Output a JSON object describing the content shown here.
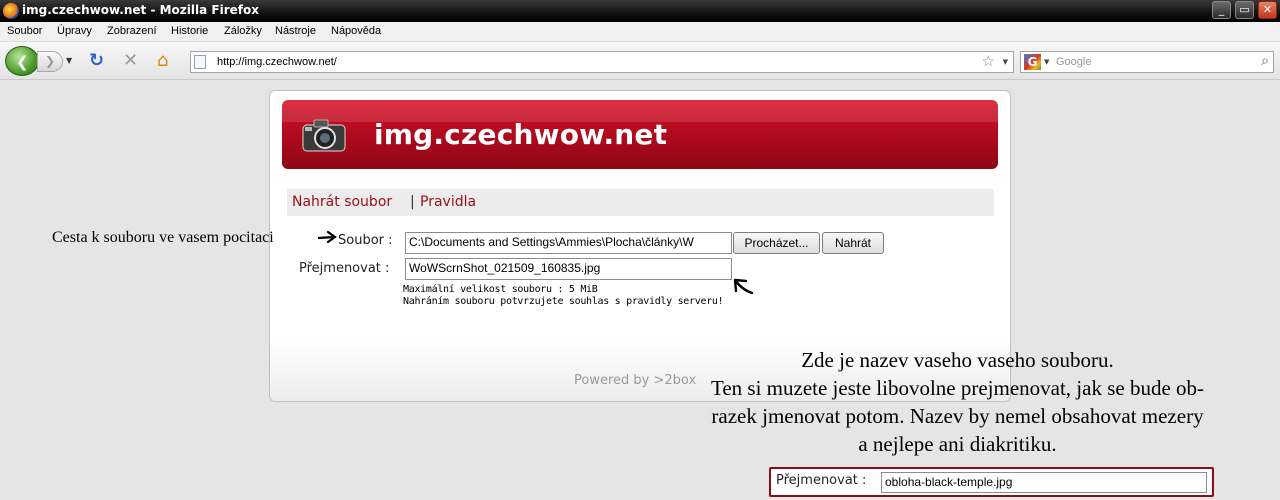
{
  "window": {
    "title": "img.czechwow.net - Mozilla Firefox"
  },
  "menu": [
    "Soubor",
    "Úpravy",
    "Zobrazení",
    "Historie",
    "Záložky",
    "Nástroje",
    "Nápověda"
  ],
  "urlbar": {
    "url": "http://img.czechwow.net/"
  },
  "searchbar": {
    "placeholder": "Google"
  },
  "page": {
    "site_title": "img.czechwow.net",
    "tabs": {
      "upload": "Nahrát soubor",
      "separator": "|",
      "rules": "Pravidla"
    },
    "form": {
      "file_label": "Soubor :",
      "file_value": "C:\\Documents and Settings\\Ammies\\Plocha\\články\\W",
      "browse_button": "Procházet...",
      "upload_button": "Nahrát",
      "rename_label": "Přejmenovat :",
      "rename_value": "WoWScrnShot_021509_160835.jpg",
      "max_size": "Maximální velikost souboru : 5 MiB",
      "agreement": "Nahráním souboru potvrzujete souhlas s pravidly serveru!"
    },
    "powered": "Powered by >2box"
  },
  "annotations": {
    "left": "Cesta k souboru ve vasem pocitaci",
    "right": [
      "Zde je nazev vaseho vaseho souboru.",
      "Ten si muzete jeste libovolne prejmenovat, jak se bude ob-",
      "razek jmenovat potom. Nazev by nemel obsahovat mezery",
      "a nejlepe ani diakritiku."
    ],
    "zoom_label": "Přejmenovat :",
    "zoom_value": "obloha-black-temple.jpg"
  },
  "colors": {
    "accent": "#b30b1e",
    "link": "#9b0d1c"
  }
}
